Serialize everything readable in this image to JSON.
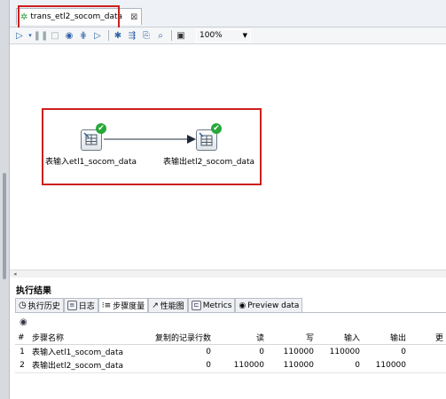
{
  "editor_tab": {
    "title": "trans_etl2_socom_data",
    "close": "⊠"
  },
  "toolbar": {
    "zoom": "100%"
  },
  "canvas": {
    "input_step": {
      "label": "表输入etl1_socom_data",
      "status": "✔"
    },
    "output_step": {
      "label": "表输出etl2_socom_data",
      "status": "✔"
    }
  },
  "results": {
    "title": "执行结果",
    "tabs": [
      {
        "label": "执行历史",
        "icon": "history-icon"
      },
      {
        "label": "日志",
        "icon": "log-icon"
      },
      {
        "label": "步骤度量",
        "icon": "metrics-list-icon"
      },
      {
        "label": "性能图",
        "icon": "chart-icon"
      },
      {
        "label": "Metrics",
        "icon": "metrics-icon"
      },
      {
        "label": "Preview data",
        "icon": "eye-icon"
      }
    ],
    "table": {
      "headers": [
        "#",
        "步骤名称",
        "复制的记录行数",
        "读",
        "写",
        "输入",
        "输出",
        "更"
      ],
      "rows": [
        [
          "1",
          "表输入etl1_socom_data",
          "0",
          "0",
          "110000",
          "110000",
          "0"
        ],
        [
          "2",
          "表输出etl2_socom_data",
          "0",
          "110000",
          "110000",
          "0",
          "110000"
        ]
      ]
    }
  },
  "colors": {
    "highlight_box": "#cc1f1f",
    "status_ok": "#27a83a",
    "toolbar_icon": "#2f63a6"
  }
}
